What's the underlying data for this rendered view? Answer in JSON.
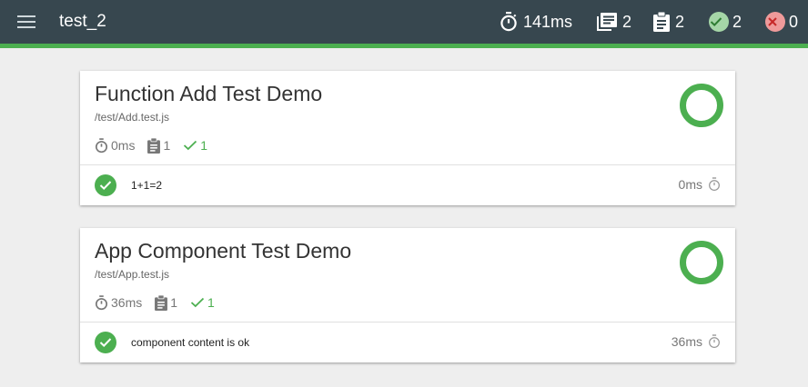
{
  "app": {
    "title": "test_2"
  },
  "summary": {
    "duration": "141ms",
    "suites": "2",
    "tests": "2",
    "passed": "2",
    "failed": "0"
  },
  "colors": {
    "topbar": "#37474f",
    "accent": "#4caf50",
    "pass": "#4caf50",
    "pass_light": "#a5d6a7",
    "fail_light": "#ef9a9a",
    "fail": "#e53935"
  },
  "suites": [
    {
      "title": "Function Add Test Demo",
      "path": "/test/Add.test.js",
      "duration": "0ms",
      "tests": "1",
      "passed": "1",
      "pass_fraction": 1.0,
      "test": {
        "name": "1+1=2",
        "duration": "0ms",
        "status": "passed"
      }
    },
    {
      "title": "App Component Test Demo",
      "path": "/test/App.test.js",
      "duration": "36ms",
      "tests": "1",
      "passed": "1",
      "pass_fraction": 1.0,
      "test": {
        "name": "component content is ok",
        "duration": "36ms",
        "status": "passed"
      }
    }
  ],
  "icons": {
    "menu": "menu-icon",
    "duration": "timer-icon",
    "suites": "library-books-icon",
    "tests": "clipboard-icon",
    "passed": "check-circle-icon",
    "failed": "close-circle-icon"
  }
}
